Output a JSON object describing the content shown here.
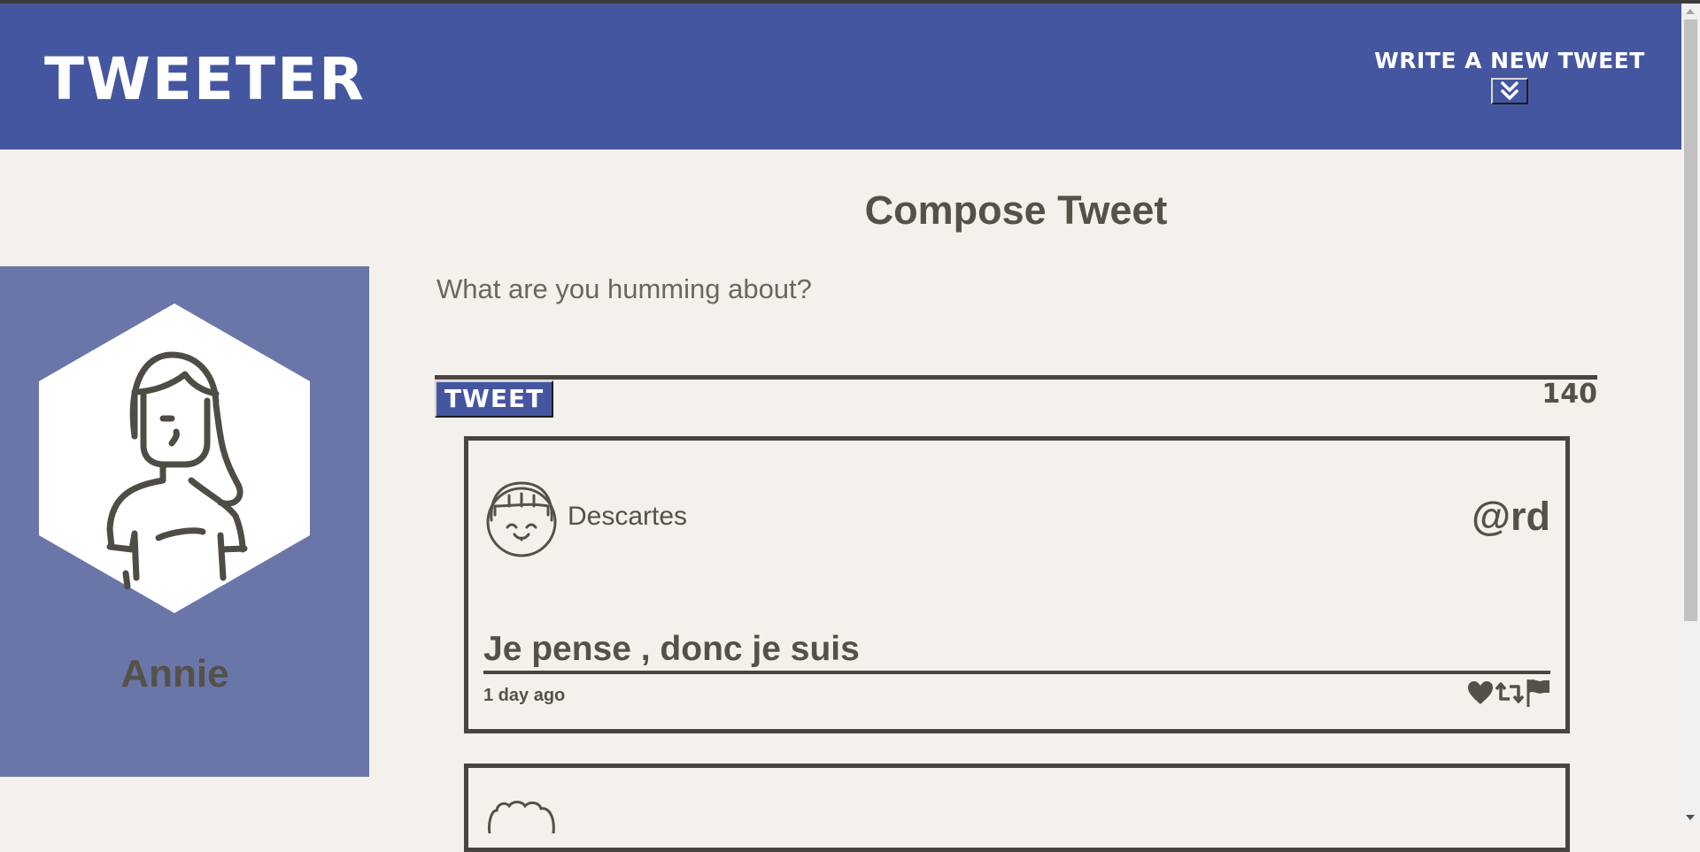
{
  "nav": {
    "brand": "TWEETER",
    "write_new_label": "WRITE A NEW TWEET",
    "toggle_icon": "double-chevron-down-icon"
  },
  "profile": {
    "name": "Annie",
    "avatar_icon": "user-avatar-icon"
  },
  "compose": {
    "title": "Compose Tweet",
    "placeholder": "What are you humming about?",
    "submit_label": "TWEET",
    "char_counter": "140"
  },
  "tweets": [
    {
      "author": "Descartes",
      "handle": "@rd",
      "text": "Je pense , donc je suis",
      "time": "1 day ago",
      "actions": [
        "heart-icon",
        "retweet-icon",
        "flag-icon"
      ]
    },
    {
      "author": "",
      "handle": "",
      "text": "",
      "time": ""
    }
  ],
  "colors": {
    "nav_bg": "#4556a0",
    "page_bg": "#f4f1ec",
    "profile_bg": "#6b76a8",
    "text": "#545149",
    "border": "#4a4440"
  }
}
